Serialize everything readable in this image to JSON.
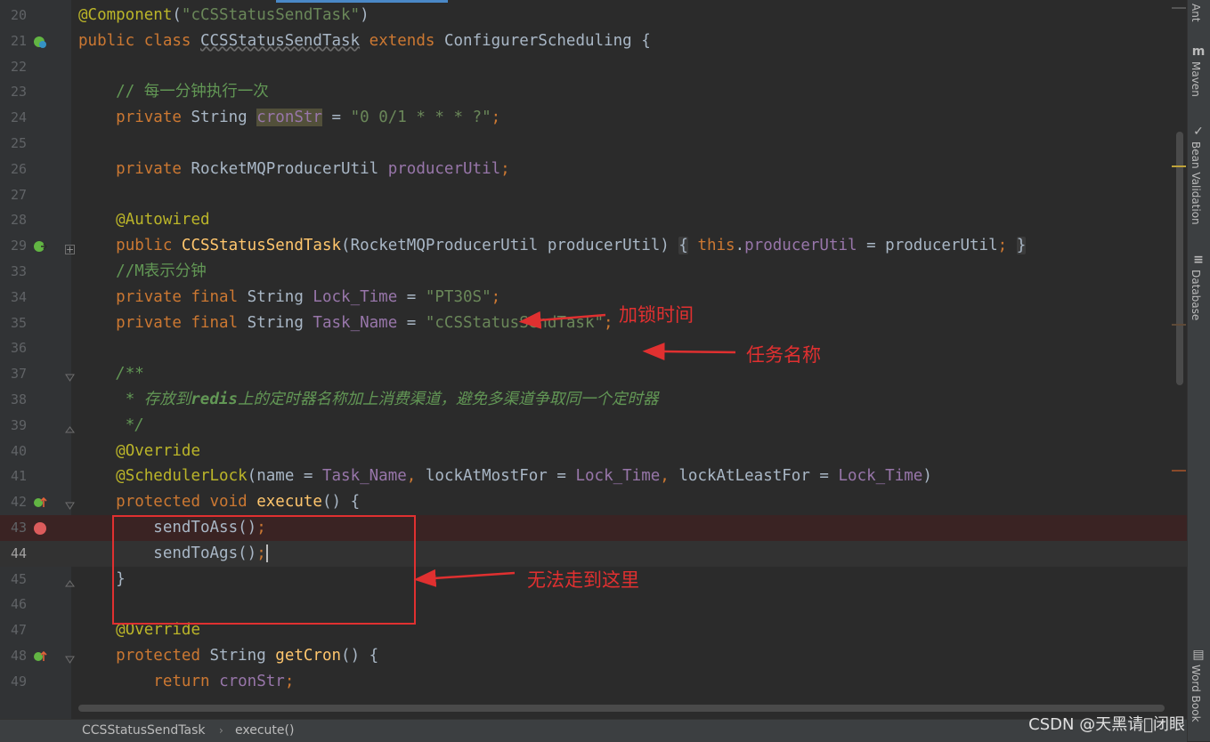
{
  "editor": {
    "lines": [
      {
        "n": "20",
        "html": "<span class=\"ann\">@Component</span>(<span class=\"str\">\"cCSStatusSendTask\"</span>)"
      },
      {
        "n": "21",
        "html": "<span class=\"kw\">public class</span> <span style=\"text-decoration:underline wavy #6a6a6a;\">CCSStatusSendTask</span> <span class=\"kw\">extends</span> ConfigurerScheduling {",
        "icon": "spring-bean-icon"
      },
      {
        "n": "22",
        "html": ""
      },
      {
        "n": "23",
        "html": "    <span class=\"cmt\">// 每一分钟执行一次</span>"
      },
      {
        "n": "24",
        "html": "    <span class=\"kw\">private</span> String <span class=\"fld hlvar\">cronStr</span> = <span class=\"str\">\"0 0/1 * * * ?\"</span><span class=\"kw\">;</span>"
      },
      {
        "n": "25",
        "html": ""
      },
      {
        "n": "26",
        "html": "    <span class=\"kw\">private</span> RocketMQProducerUtil <span class=\"fld\">producerUtil</span><span class=\"kw\">;</span>"
      },
      {
        "n": "27",
        "html": ""
      },
      {
        "n": "28",
        "html": "    <span class=\"ann\">@Autowired</span>"
      },
      {
        "n": "29",
        "html": "    <span class=\"kw\">public</span> <span class=\"fn\">CCSStatusSendTask</span>(RocketMQProducerUtil producerUtil) <span class=\"brace\">{</span> <span class=\"kw\">this</span>.<span class=\"fld\">producerUtil</span> = producerUtil<span class=\"kw\">;</span> <span class=\"brace\">}</span>",
        "icon": "spring-autowire-icon",
        "fold": "expand"
      },
      {
        "n": "33",
        "html": "    <span class=\"cmt\">//M表示分钟</span>"
      },
      {
        "n": "34",
        "html": "    <span class=\"kw\">private final</span> String <span class=\"fld\">Lock_Time</span> = <span class=\"str\">\"PT30S\"</span><span class=\"kw\">;</span>"
      },
      {
        "n": "35",
        "html": "    <span class=\"kw\">private final</span> String <span class=\"fld\">Task_Name</span> = <span class=\"str\">\"cCSStatusSendTask\"</span><span class=\"kw\">;</span>"
      },
      {
        "n": "36",
        "html": ""
      },
      {
        "n": "37",
        "html": "    <span class=\"doc\">/**</span>",
        "fold": "collapse"
      },
      {
        "n": "38",
        "html": "     <span class=\"doc\">* 存放到<b>redis</b>上的定时器名称加上消费渠道，避免多渠道争取同一个定时器</span>"
      },
      {
        "n": "39",
        "html": "     <span class=\"doc\">*/</span>",
        "fold": "end"
      },
      {
        "n": "40",
        "html": "    <span class=\"ann\">@Override</span>"
      },
      {
        "n": "41",
        "html": "    <span class=\"ann\">@SchedulerLock</span>(name = <span class=\"fld\">Task_Name</span><span class=\"kw\">,</span> lockAtMostFor = <span class=\"fld\">Lock_Time</span><span class=\"kw\">,</span> lockAtLeastFor = <span class=\"fld\">Lock_Time</span>)"
      },
      {
        "n": "42",
        "html": "    <span class=\"kw\">protected void</span> <span class=\"fn\">execute</span>() {",
        "icon": "override-icon",
        "fold": "collapse"
      },
      {
        "n": "43",
        "html": "        sendToAss()<span class=\"kw\">;</span>",
        "icon": "breakpoint-icon",
        "state": "bp"
      },
      {
        "n": "44",
        "html": "        sendToAgs()<span class=\"kw\">;</span><span class=\"caret\"></span>",
        "state": "caret"
      },
      {
        "n": "45",
        "html": "    }",
        "fold": "end"
      },
      {
        "n": "46",
        "html": ""
      },
      {
        "n": "47",
        "html": "    <span class=\"ann\">@Override</span>"
      },
      {
        "n": "48",
        "html": "    <span class=\"kw\">protected</span> String <span class=\"fn\">getCron</span>() {",
        "icon": "override-icon",
        "fold": "collapse"
      },
      {
        "n": "49",
        "html": "        <span class=\"kw\">return</span> <span class=\"fld\">cronStr</span><span class=\"kw\">;</span>"
      }
    ]
  },
  "annotations": {
    "lock_time": "加锁时间",
    "task_name": "任务名称",
    "unreachable": "无法走到这里"
  },
  "tool_windows": [
    "Ant",
    "Maven",
    "Bean Validation",
    "Database",
    "Word Book"
  ],
  "breadcrumb": [
    "CCSStatusSendTask",
    "execute()"
  ],
  "watermark": "CSDN @天黑请\u0000闭眼",
  "colors": {
    "annotation_red": "#e03030",
    "editor_bg": "#2b2b2b",
    "keyword": "#cc7832",
    "string": "#6a8759"
  }
}
